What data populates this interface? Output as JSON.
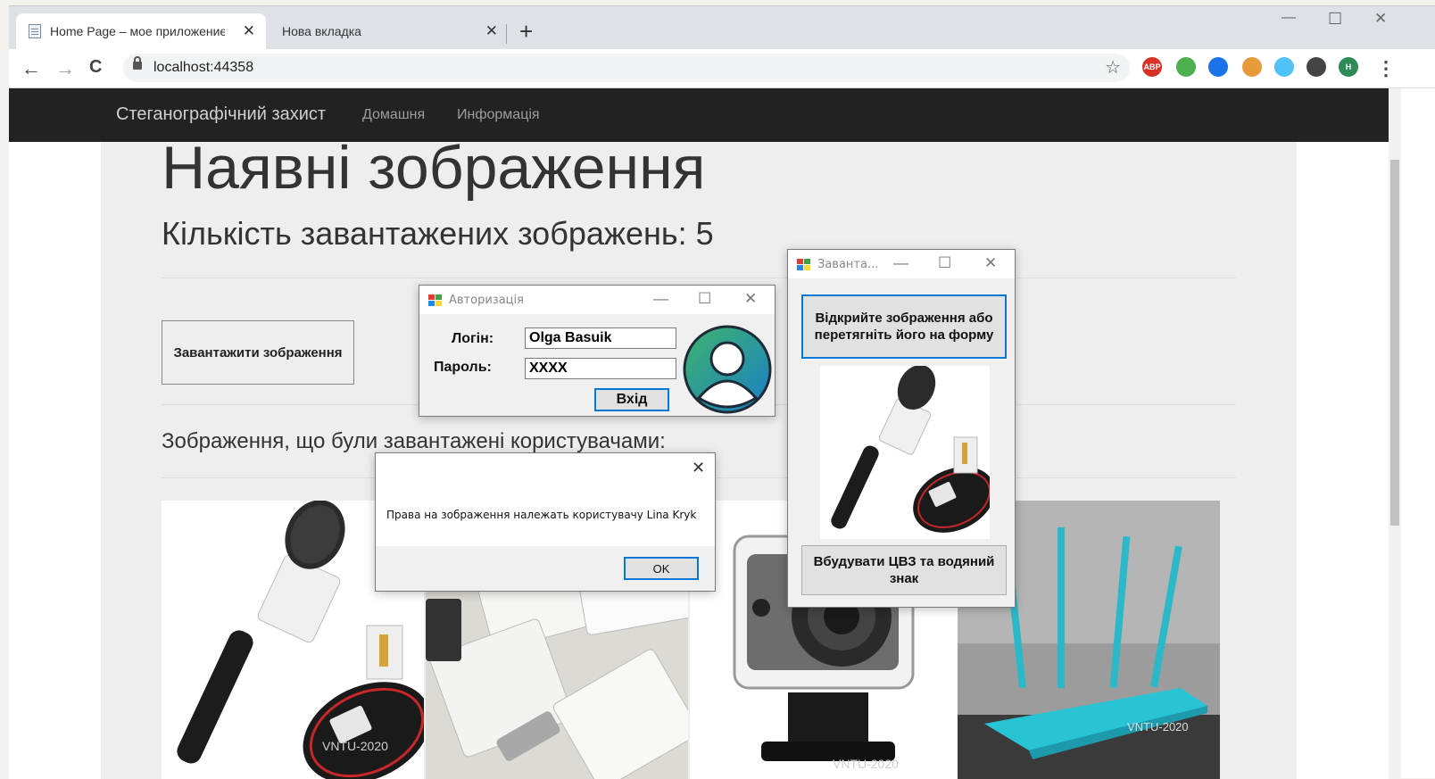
{
  "browser": {
    "tabs": [
      {
        "title": "Home Page – мое приложение ASP.NET",
        "close": "✕"
      },
      {
        "title": "Нова вкладка",
        "close": "✕"
      }
    ],
    "new_tab": "+",
    "url": "localhost:44358",
    "controls": {
      "minimize": "—",
      "maximize": "☐",
      "close": "✕"
    },
    "nav": {
      "back": "←",
      "forward": "→",
      "reload": "C"
    },
    "extensions": [
      {
        "name": "adblock-plus",
        "label": "ABP",
        "color": "#d93025"
      },
      {
        "name": "download-arrow",
        "label": "",
        "color": "#4caf50"
      },
      {
        "name": "bookmark",
        "label": "",
        "color": "#1a73e8"
      },
      {
        "name": "cookie",
        "label": "",
        "color": "#e69b3a"
      },
      {
        "name": "diamond",
        "label": "",
        "color": "#4fc3f7"
      },
      {
        "name": "puzzle",
        "label": "",
        "color": "#444444"
      },
      {
        "name": "profile",
        "label": "H",
        "color": "#2e8b57"
      }
    ]
  },
  "site": {
    "brand": "Стеганографічний захист",
    "nav": [
      "Домашня",
      "Информація"
    ],
    "heading": "Наявні зображення",
    "count_text": "Кількість завантажених зображень: 5",
    "upload_button": "Завантажити зображення",
    "uploaded_by_users": "Зображення, що були завантажені користувачами:"
  },
  "auth_dialog": {
    "title": "Авторизація",
    "login_label": "Логін:",
    "login_value": "Olga Basuik",
    "password_label": "Пароль:",
    "password_value": "XXXX",
    "submit": "Вхід"
  },
  "message_box": {
    "close": "✕",
    "text": "Права на зображення належать користувачу Lina Kryk",
    "ok": "OK"
  },
  "upload_dialog": {
    "title": "Заванта...",
    "open_button": "Відкрийте зображення або перетягніть його на форму",
    "embed_button": "Вбудувати ЦВЗ та водяний знак"
  },
  "watermark": "VNTU-2020",
  "colors": {
    "navbar": "#222222",
    "jumbotron": "#eeeeee",
    "accent": "#0078d7",
    "router": "#2bb8c9"
  }
}
